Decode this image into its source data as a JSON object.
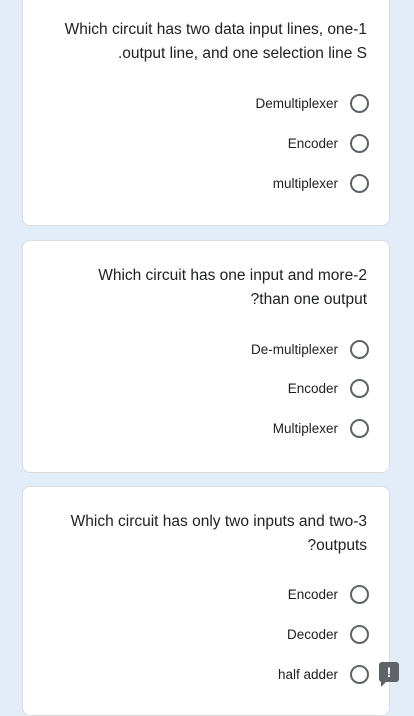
{
  "questions": [
    {
      "text_line1": "Which circuit has two data input lines, one-1",
      "text_line2": ".output line, and one selection line S",
      "options": [
        "Demultiplexer",
        "Encoder",
        "multiplexer"
      ]
    },
    {
      "text_line1": "Which circuit has one input and more-2",
      "text_line2": "?than one output",
      "options": [
        "De-multiplexer",
        "Encoder",
        "Multiplexer"
      ]
    },
    {
      "text_line1": "Which circuit has only two inputs and two-3",
      "text_line2": "?outputs",
      "options": [
        "Encoder",
        "Decoder",
        "half adder"
      ]
    }
  ],
  "feedback": {
    "icon": "feedback-icon",
    "glyph": "!"
  },
  "colors": {
    "page_background": "#e3edf7",
    "card_background": "#ffffff",
    "radio_border": "#5f6368",
    "text": "#202124"
  }
}
